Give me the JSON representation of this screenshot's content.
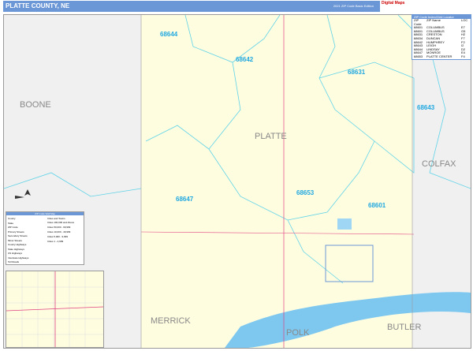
{
  "header": {
    "title": "PLATTE COUNTY, NE",
    "edition": "2021 ZIP Code Basic Edition",
    "logo": "Digital Maps"
  },
  "counties": {
    "main": "PLATTE",
    "neighbors": [
      "BOONE",
      "COLFAX",
      "MERRICK",
      "POLK",
      "BUTLER"
    ]
  },
  "zip_labels": [
    "68644",
    "68642",
    "68631",
    "68643",
    "68647",
    "68653",
    "68601"
  ],
  "zip_table": {
    "title": "ZIP Code Index/Grid Locator",
    "headers": [
      "ZIP Code",
      "ZIP Name",
      "LOC"
    ],
    "rows": [
      [
        "68601",
        "COLUMBUS",
        "E7"
      ],
      [
        "68601",
        "COLUMBUS",
        "G5"
      ],
      [
        "68631",
        "CRESTON",
        "H2"
      ],
      [
        "68634",
        "DUNCAN",
        "F7"
      ],
      [
        "68642",
        "HUMPHREY",
        "F2"
      ],
      [
        "68643",
        "LEIGH",
        "I2"
      ],
      [
        "68644",
        "LINDSAY",
        "D2"
      ],
      [
        "68647",
        "MONROE",
        "E4"
      ],
      [
        "68653",
        "PLATTE CENTER",
        "F4"
      ]
    ]
  },
  "legend": {
    "title": "ZIP Code Wall Map",
    "items": [
      "County",
      "State",
      "ZIP Code",
      "Primary Streets",
      "Secondary Streets",
      "Minor Streets",
      "County Highways",
      "State Highways",
      "US Highways",
      "Interstate Highways",
      "Toll Roads"
    ],
    "cities_title": "Cities and Towns",
    "cities": [
      "Cities 100,000 and Above",
      "Cities 50,000 - 99,999",
      "Cities 10,000 - 49,999",
      "Cities 5,000 - 9,999",
      "Cities 1 - 4,999"
    ]
  },
  "colors": {
    "header": "#6b97d6",
    "county_fill": "#fffde0",
    "neighbor_fill": "#f0f0f0",
    "zip_line": "#5fd3e8",
    "water": "#7ec8f0"
  }
}
